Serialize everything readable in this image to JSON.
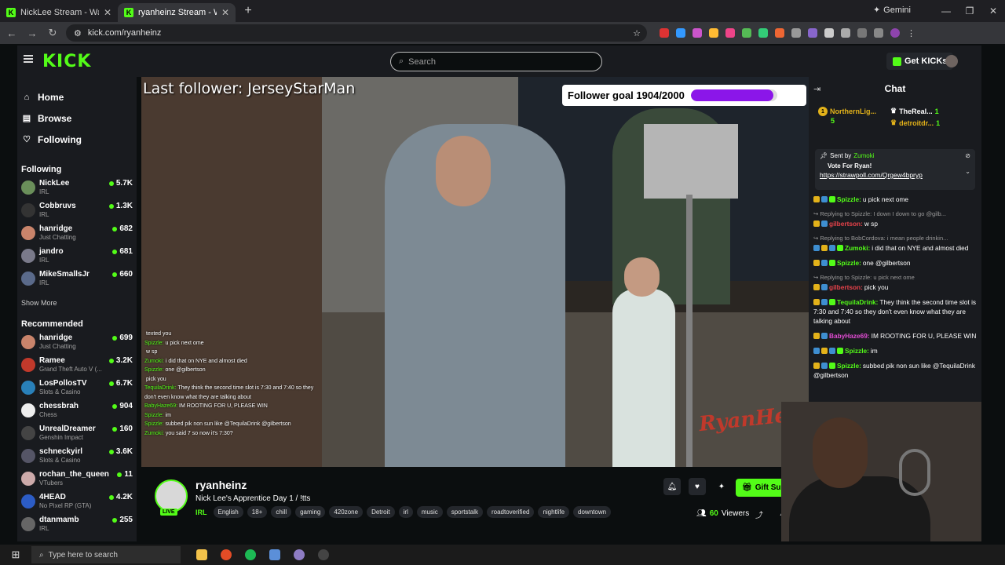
{
  "browser": {
    "tabs": [
      {
        "title": "NickLee Stream - Watch Live o",
        "active": false
      },
      {
        "title": "ryanheinz Stream - Watch l",
        "active": true
      }
    ],
    "url": "kick.com/ryanheinz",
    "gemini_label": "Gemini"
  },
  "topnav": {
    "logo": "KICK",
    "search_placeholder": "Search",
    "get_kicks_label": "Get KICKs"
  },
  "sidebar": {
    "nav": [
      {
        "label": "Home",
        "icon": "home-icon"
      },
      {
        "label": "Browse",
        "icon": "browse-icon"
      },
      {
        "label": "Following",
        "icon": "heart-icon"
      }
    ],
    "following_title": "Following",
    "following": [
      {
        "name": "NickLee",
        "category": "IRL",
        "viewers": "5.7K"
      },
      {
        "name": "Cobbruvs",
        "category": "IRL",
        "viewers": "1.3K"
      },
      {
        "name": "hanridge",
        "category": "Just Chatting",
        "viewers": "682"
      },
      {
        "name": "jandro",
        "category": "IRL",
        "viewers": "681"
      },
      {
        "name": "MikeSmallsJr",
        "category": "IRL",
        "viewers": "660"
      }
    ],
    "show_more": "Show More",
    "recommended_title": "Recommended",
    "recommended": [
      {
        "name": "hanridge",
        "category": "Just Chatting",
        "viewers": "699"
      },
      {
        "name": "Ramee",
        "category": "Grand Theft Auto V (...",
        "viewers": "3.2K"
      },
      {
        "name": "LosPollosTV",
        "category": "Slots & Casino",
        "viewers": "6.7K"
      },
      {
        "name": "chessbrah",
        "category": "Chess",
        "viewers": "904"
      },
      {
        "name": "UnrealDreamer",
        "category": "Genshin Impact",
        "viewers": "160"
      },
      {
        "name": "schneckyirl",
        "category": "Slots & Casino",
        "viewers": "3.6K"
      },
      {
        "name": "rochan_the_queen",
        "category": "VTubers",
        "viewers": "11"
      },
      {
        "name": "4HEAD",
        "category": "No Pixel RP (GTA)",
        "viewers": "4.2K"
      },
      {
        "name": "dtanmamb",
        "category": "IRL",
        "viewers": "255"
      }
    ]
  },
  "video": {
    "last_follower": "Last follower: JerseyStarMan",
    "goal_label": "Follower goal 1904/2000",
    "goal_progress": 0.952,
    "watermark": "RyanHeinz",
    "overlay_chat": [
      {
        "user": "",
        "text": "texted you"
      },
      {
        "user": "Spizzle:",
        "text": "u pick next ome"
      },
      {
        "user": "",
        "text": "w sp"
      },
      {
        "user": "Zumoki:",
        "text": "i did that on NYE and almost died"
      },
      {
        "user": "Spizzle:",
        "text": "one @gilbertson"
      },
      {
        "user": "",
        "text": "pick you"
      },
      {
        "user": "TequilaDrink:",
        "text": "They think the second time slot is 7:30 and 7:40 so they don't even know what they are talking about"
      },
      {
        "user": "BabyHaze69:",
        "text": "IM ROOTING FOR U, PLEASE WIN"
      },
      {
        "user": "Spizzle:",
        "text": "im"
      },
      {
        "user": "Spizzle:",
        "text": "subbed pik non sun like @TequilaDrink @gilbertson"
      },
      {
        "user": "Zumoki:",
        "text": "you said 7 so now it's 7:30?"
      }
    ]
  },
  "stream": {
    "name": "ryanheinz",
    "title": "Nick Lee's Apprentice Day 1 / !tts",
    "live_label": "LIVE",
    "category": "IRL",
    "tags": [
      "English",
      "18+",
      "chill",
      "gaming",
      "420zone",
      "Detroit",
      "irl",
      "music",
      "sportstalk",
      "roadtoverified",
      "nightlife",
      "downtown"
    ],
    "gift_subs_label": "Gift Subs",
    "viewers": "60",
    "viewers_label": "Viewers"
  },
  "chat": {
    "title": "Chat",
    "gifters": [
      {
        "name": "NorthernLig...",
        "count": "5"
      },
      {
        "name": "TheReal...",
        "count": "1"
      },
      {
        "name": "detroitdr...",
        "count": "1"
      }
    ],
    "pinned": {
      "sent_by_label": "Sent by",
      "sender": "Zumoki",
      "message": "Vote For Ryan!",
      "link": "https://strawpoll.com/Qrgew4bpryp"
    },
    "messages": [
      {
        "reply": "",
        "user": "Spizzle:",
        "color": "#53fc18",
        "text": "u pick next ome"
      },
      {
        "reply": "Replying to Spizzle: I down I down to go @gilb...",
        "user": "gilbertson:",
        "color": "#e8424a",
        "text": "w sp"
      },
      {
        "reply": "Replying to BobCordova: i mean people drinkin...",
        "user": "Zumoki:",
        "color": "#53fc18",
        "text": "i did that on NYE and almost died"
      },
      {
        "reply": "",
        "user": "Spizzle:",
        "color": "#53fc18",
        "text": "one @gilbertson"
      },
      {
        "reply": "Replying to Spizzle: u pick next ome",
        "user": "gilbertson:",
        "color": "#e8424a",
        "text": "pick you"
      },
      {
        "reply": "",
        "user": "TequilaDrink:",
        "color": "#53fc18",
        "text": "They think the second time slot is 7:30 and 7:40 so they don't even know what they are talking about"
      },
      {
        "reply": "",
        "user": "BabyHaze69:",
        "color": "#e24cd4",
        "text": "IM ROOTING FOR U, PLEASE WIN"
      },
      {
        "reply": "",
        "user": "Spizzle:",
        "color": "#53fc18",
        "text": "im"
      },
      {
        "reply": "",
        "user": "Spizzle:",
        "color": "#53fc18",
        "text": "subbed pik non sun like @TequilaDrink @gilbertson"
      }
    ]
  },
  "taskbar": {
    "search_placeholder": "Type here to search"
  }
}
